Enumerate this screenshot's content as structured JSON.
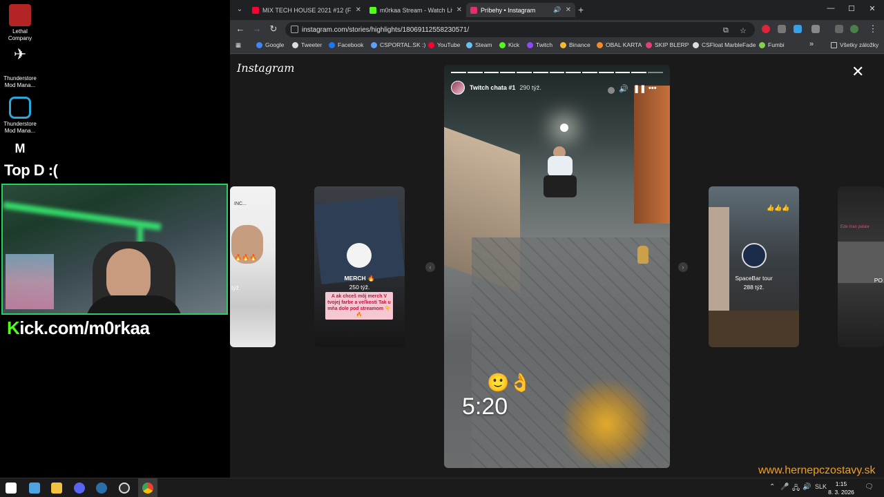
{
  "desktop": {
    "icons": [
      {
        "label": "Lethal Company",
        "color": "#b32424"
      },
      {
        "label": "Thunderstore Mod Mana...",
        "color": "#eeeeee"
      },
      {
        "label": "Thunderstore Mod Mana...",
        "color": "#29a8d9"
      },
      {
        "label": "M",
        "color": "#ffffff"
      }
    ],
    "overlay_text": "Top D :(",
    "stream_banner_k": "K",
    "stream_banner_rest": "ick.com/m0rkaa"
  },
  "browser": {
    "tabs": [
      {
        "label": "MIX TECH HOUSE 2021 #12 (Fi...",
        "icon_color": "#ff0033",
        "close": "✕"
      },
      {
        "label": "m0rkaa Stream - Watch Live on...",
        "icon_color": "#53fc18",
        "close": "✕"
      },
      {
        "label": "Príbehy • Instagram",
        "icon_color": "#e1306c",
        "audio": "🔊",
        "close": "✕"
      }
    ],
    "new_tab": "+",
    "window_controls": [
      "—",
      "☐",
      "✕"
    ],
    "url": "instagram.com/stories/highlights/18069112558230571/",
    "bookmarks": [
      {
        "label": "Google",
        "color": "#4285f4"
      },
      {
        "label": "Tweeter",
        "color": "#dddddd"
      },
      {
        "label": "Facebook",
        "color": "#1877f2"
      },
      {
        "label": "CSPORTAL.SK :)",
        "color": "#5aa0ff"
      },
      {
        "label": "YouTube",
        "color": "#ff0033"
      },
      {
        "label": "Steam",
        "color": "#66c0f4"
      },
      {
        "label": "Kick",
        "color": "#53fc18"
      },
      {
        "label": "Twitch",
        "color": "#9146ff"
      },
      {
        "label": "Binance",
        "color": "#f3ba2f"
      },
      {
        "label": "OBAL KARTA",
        "color": "#f08c2a"
      },
      {
        "label": "SKIP BLERP",
        "color": "#e53e7a"
      },
      {
        "label": "CSFloat MarbleFade",
        "color": "#dddddd"
      },
      {
        "label": "Fumbi",
        "color": "#7fd14a"
      }
    ],
    "bookmarks_more": "»",
    "all_bookmarks": "Všetky záložky"
  },
  "instagram": {
    "logo": "Instagram",
    "close": "✕",
    "story": {
      "username": "Twitch chata #1",
      "time": "290 týž.",
      "segments_total": 13,
      "segments_done": 12,
      "emoji": "🙂👌",
      "overlay_time": "5:20"
    },
    "side_cards": [
      {
        "caption": "týž.",
        "top_text": "INC...",
        "emoji": "🔥🔥🔥"
      },
      {
        "title": "MERCH 🔥",
        "caption": "250 týž.",
        "note": "A ak chceš môj merch V tvojej farbe a veľkosti Tak u mňa dole pod streamom 👇🔥"
      },
      {
        "title": "SpaceBar tour",
        "caption": "288 týž.",
        "emoji": "👍👍👍"
      },
      {
        "top_text": "Ede man pataw",
        "caption": "PO"
      }
    ]
  },
  "watermark": "www.hernepczostavy.sk",
  "taskbar": {
    "tray_lang": "SLK",
    "time": "1:15",
    "date": "8. 3. 2026"
  }
}
